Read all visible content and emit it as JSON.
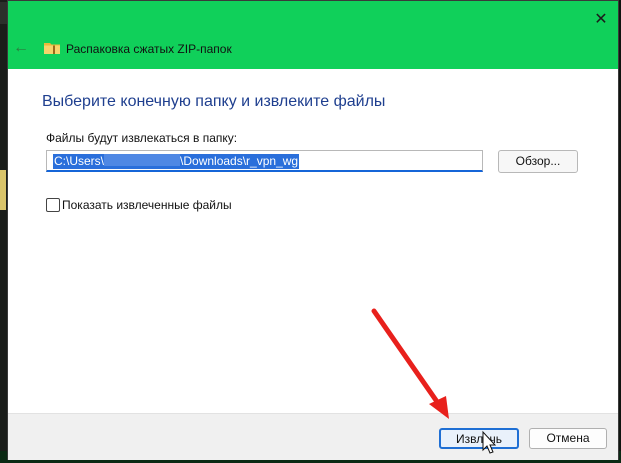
{
  "window": {
    "title": "Распаковка сжатых ZIP-папок",
    "close_glyph": "✕",
    "back_glyph": "←",
    "titlebar_color": "#10d05a"
  },
  "main": {
    "heading": "Выберите конечную папку и извлеките файлы",
    "path_label": "Файлы будут извлекаться в папку:",
    "path_prefix": "C:\\Users\\",
    "path_suffix": "\\Downloads\\r_vpn_wg",
    "browse_label": "Обзор...",
    "show_files_label": "Показать извлеченные файлы",
    "show_files_checked": false
  },
  "footer": {
    "extract_label": "Извлечь",
    "cancel_label": "Отмена"
  },
  "annotation": {
    "arrow_color": "#e8201c",
    "arrow_target": "extract-button"
  },
  "colors": {
    "accent": "#1f6fd4",
    "heading": "#1f3f8f",
    "selection": "#2a6fdb"
  }
}
